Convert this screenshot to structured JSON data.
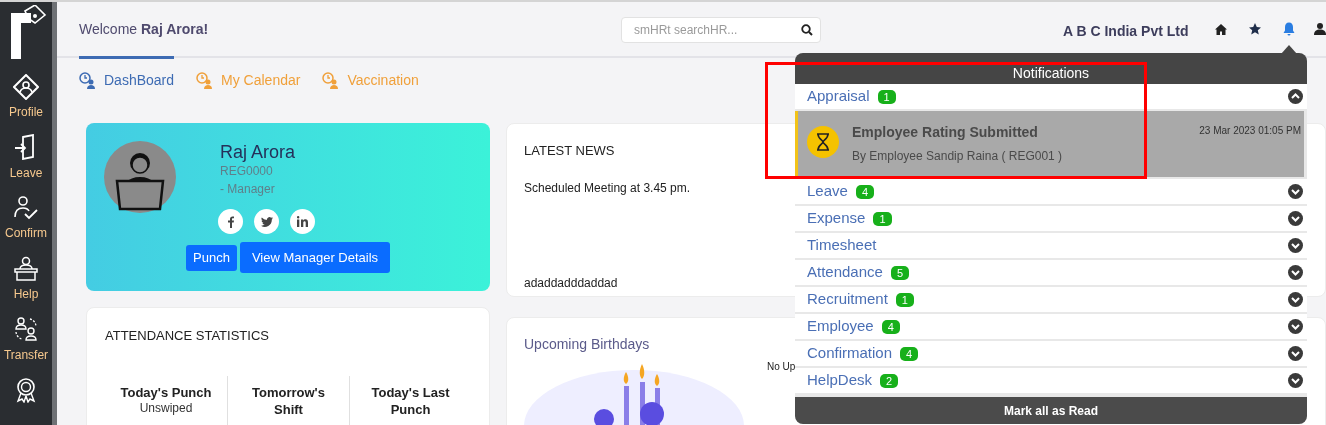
{
  "sidebar": {
    "items": [
      {
        "label": "Profile",
        "kind": "profile"
      },
      {
        "label": "Leave",
        "kind": "leave"
      },
      {
        "label": "Confirm",
        "kind": "confirm"
      },
      {
        "label": "Help",
        "kind": "help"
      },
      {
        "label": "Transfer",
        "kind": "transfer"
      },
      {
        "kind": "award"
      }
    ]
  },
  "header": {
    "welcome": "Welcome **Raj Arora!**",
    "search": {
      "placeholder": "smHRt searchHR..."
    },
    "company": "A B C India Pvt Ltd"
  },
  "tabs": [
    {
      "label": "DashBoard",
      "selected": true
    },
    {
      "label": "My Calendar",
      "selected": false
    },
    {
      "label": "Vaccination",
      "selected": false
    }
  ],
  "profile": {
    "name": "Raj Arora",
    "code": "REG0000",
    "role": "- Manager",
    "buttons": [
      "Punch",
      "View Manager Details"
    ]
  },
  "latest_news": {
    "title": "LATEST NEWS",
    "items": [
      "Scheduled Meeting at 3.45 pm.",
      "adaddadddaddad"
    ]
  },
  "attendance": {
    "title": "ATTENDANCE STATISTICS",
    "stats": [
      {
        "label": "Today's Punch",
        "value": "Unswiped"
      },
      {
        "label": "Tomorrow's Shift"
      },
      {
        "label": "Today's Last Punch"
      }
    ]
  },
  "birthdays": {
    "title": "Upcoming Birthdays",
    "note": "No Up"
  },
  "notifications": {
    "title": "Notifications",
    "categories": [
      {
        "label": "Appraisal",
        "count": "1",
        "expanded": true,
        "items": [
          {
            "title": "Employee Rating Submitted",
            "by": "By Employee Sandip Raina ( REG001 )",
            "time": "23 Mar 2023 01:05 PM"
          }
        ]
      },
      {
        "label": "Leave",
        "count": "4",
        "expanded": false
      },
      {
        "label": "Expense",
        "count": "1",
        "expanded": false
      },
      {
        "label": "Timesheet",
        "expanded": false
      },
      {
        "label": "Attendance",
        "count": "5",
        "expanded": false
      },
      {
        "label": "Recruitment",
        "count": "1",
        "expanded": false
      },
      {
        "label": "Employee",
        "count": "4",
        "expanded": false
      },
      {
        "label": "Confirmation",
        "count": "4",
        "expanded": false
      },
      {
        "label": "HelpDesk",
        "count": "2",
        "expanded": false
      }
    ],
    "footer": "Mark all as Read"
  }
}
